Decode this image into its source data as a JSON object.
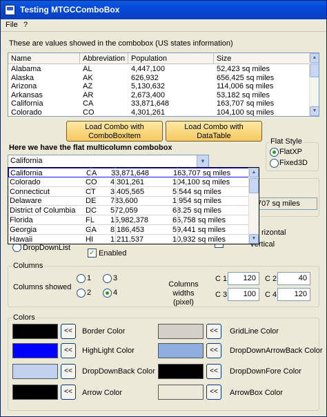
{
  "window": {
    "title": "Testing MTGCComboBox"
  },
  "menu": {
    "file": "File",
    "help": "?"
  },
  "intro_text": "These are values showed in the combobox (US states information)",
  "listview": {
    "headers": [
      "Name",
      "Abbreviation",
      "Population",
      "Size"
    ],
    "rows": [
      [
        "Alabama",
        "AL",
        "4,447,100",
        "52,423 sq miles"
      ],
      [
        "Alaska",
        "AK",
        "626,932",
        "656,425 sq miles"
      ],
      [
        "Arizona",
        "AZ",
        "5,130,632",
        "114,006 sq miles"
      ],
      [
        "Arkansas",
        "AR",
        "2,673,400",
        "53,182 sq miles"
      ],
      [
        "California",
        "CA",
        "33,871,648",
        "163,707 sq miles"
      ],
      [
        "Colorado",
        "CO",
        "4,301,261",
        "104,100 sq miles"
      ]
    ]
  },
  "buttons": {
    "load_item": "Load Combo with\nComboBoxItem",
    "load_table": "Load Combo with\nDataTable"
  },
  "flat_heading": "Here we have the flat multicolumn combobox",
  "combo_value": "California",
  "dropdown_rows": [
    [
      "California",
      "CA",
      "33,871,648",
      "163,707 sq miles"
    ],
    [
      "Colorado",
      "CO",
      "4,301,261",
      "104,100 sq miles"
    ],
    [
      "Connecticut",
      "CT",
      "3,405,565",
      "5,544 sq miles"
    ],
    [
      "Delaware",
      "DE",
      "783,600",
      "1,954 sq miles"
    ],
    [
      "District of Columbia",
      "DC",
      "572,059",
      "68.25 sq miles"
    ],
    [
      "Florida",
      "FL",
      "15,982,378",
      "65,758 sq miles"
    ],
    [
      "Georgia",
      "GA",
      "8,186,453",
      "59,441 sq miles"
    ],
    [
      "Hawaii",
      "HI",
      "1,211,537",
      "10,932 sq miles"
    ]
  ],
  "flat_style": {
    "title": "Flat Style",
    "opt1": "FlatXP",
    "opt2": "Fixed3D"
  },
  "behind": {
    "size_value": "707 sq miles",
    "horizontal": "rizontal",
    "vertical": "Vertical",
    "dropdownlist": "DropDownList",
    "enabled": "Enabled"
  },
  "columns": {
    "title": "Columns",
    "showed_label": "Columns showed",
    "opts": [
      "1",
      "3",
      "2",
      "4"
    ],
    "widths_label": "Columns widths\n(pixel)",
    "c1_label": "C 1",
    "c1": "120",
    "c2_label": "C 2",
    "c2": "40",
    "c3_label": "C 3",
    "c3": "100",
    "c4_label": "C 4",
    "c4": "120"
  },
  "colors": {
    "title": "Colors",
    "btn": "<<",
    "border": "Border Color",
    "highlight": "HighLight Color",
    "ddback": "DropDownBack Color",
    "arrow": "Arrow Color",
    "gridline": "GridLine Color",
    "ddarrowback": "DropDownArrowBack Color",
    "ddfore": "DropDownFore Color",
    "arrowbox": "ArrowBox Color",
    "swatch_border": "#000000",
    "swatch_highlight": "#0000ff",
    "swatch_ddback": "#c1d2ee",
    "swatch_arrow": "#000000",
    "swatch_gridline": "#d4d0c8",
    "swatch_ddarrowback": "#8eaee0",
    "swatch_ddfore": "#000000",
    "swatch_arrowbox": "#ece9d8"
  }
}
